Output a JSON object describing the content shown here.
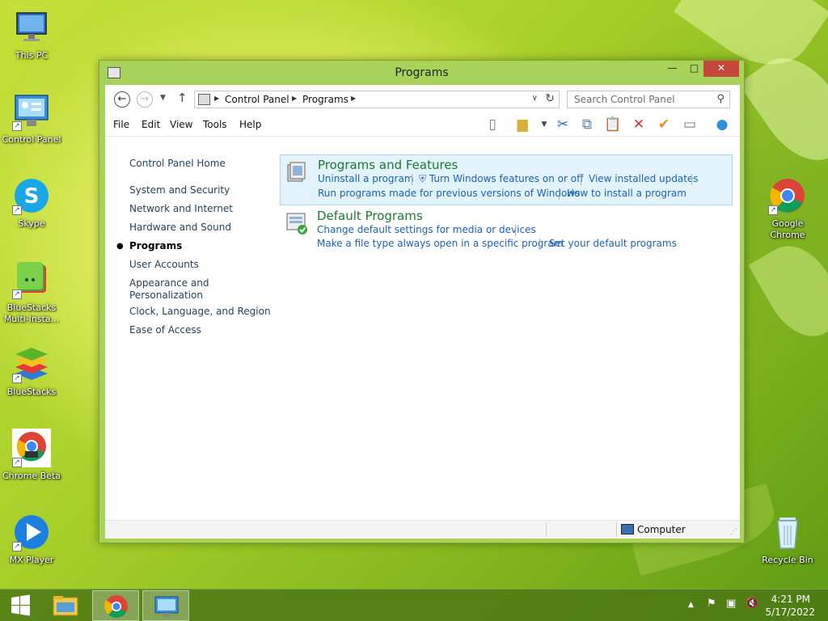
{
  "desktop": {
    "icons": [
      {
        "label": "This PC"
      },
      {
        "label": "Control Panel"
      },
      {
        "label": "Skype"
      },
      {
        "label": "BlueStacks Multi-Insta..."
      },
      {
        "label": "BlueStacks"
      },
      {
        "label": "Chrome Beta"
      },
      {
        "label": "MX Player"
      },
      {
        "label": "Google Chrome"
      },
      {
        "label": "Recycle Bin"
      }
    ]
  },
  "window": {
    "title": "Programs",
    "controls": {
      "minimize": "—",
      "maximize": "□",
      "close": "✕"
    }
  },
  "address": {
    "breadcrumbs": [
      "Control Panel",
      "Programs"
    ],
    "search_placeholder": "Search Control Panel"
  },
  "menu": [
    "File",
    "Edit",
    "View",
    "Tools",
    "Help"
  ],
  "left_nav": {
    "home": "Control Panel Home",
    "items": [
      "System and Security",
      "Network and Internet",
      "Hardware and Sound",
      "Programs",
      "User Accounts",
      "Appearance and",
      "Personalization",
      "Clock, Language, and Region",
      "Ease of Access"
    ],
    "current": "Programs"
  },
  "categories": {
    "programs_features": {
      "title": "Programs and Features",
      "links": [
        "Uninstall a program",
        "Turn Windows features on or off",
        "View installed updates",
        "Run programs made for previous versions of Windows",
        "How to install a program"
      ]
    },
    "default_programs": {
      "title": "Default Programs",
      "links": [
        "Change default settings for media or devices",
        "Make a file type always open in a specific program",
        "Set your default programs"
      ]
    }
  },
  "statusbar": {
    "location": "Computer"
  },
  "taskbar": {
    "time": "4:21 PM",
    "date": "5/17/2022"
  }
}
